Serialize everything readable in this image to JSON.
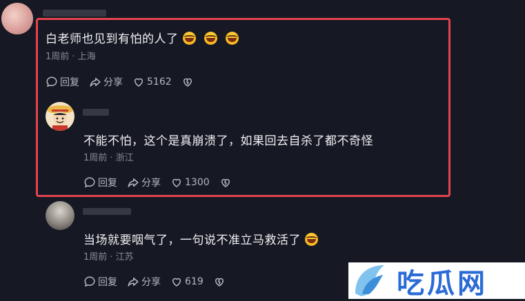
{
  "comment1": {
    "text": "白老师也见到有怕的人了",
    "emoji_count": 3,
    "meta": "1周前 · 上海",
    "reply_label": "回复",
    "share_label": "分享",
    "likes": "5162"
  },
  "reply1": {
    "text": "不能不怕，这个是真崩溃了，如果回去自杀了都不奇怪",
    "meta": "1周前 · 浙江",
    "reply_label": "回复",
    "share_label": "分享",
    "likes": "1300"
  },
  "reply2": {
    "text": "当场就要咽气了，一句说不准立马救活了",
    "emoji_count": 1,
    "meta": "1周前 · 江苏",
    "reply_label": "回复",
    "share_label": "分享",
    "likes": "619"
  },
  "watermark": {
    "text": "吃瓜网"
  },
  "colors": {
    "background": "#161823",
    "highlight_border": "#e5444f",
    "text": "#f2f2f4",
    "meta": "#8a8b93"
  }
}
